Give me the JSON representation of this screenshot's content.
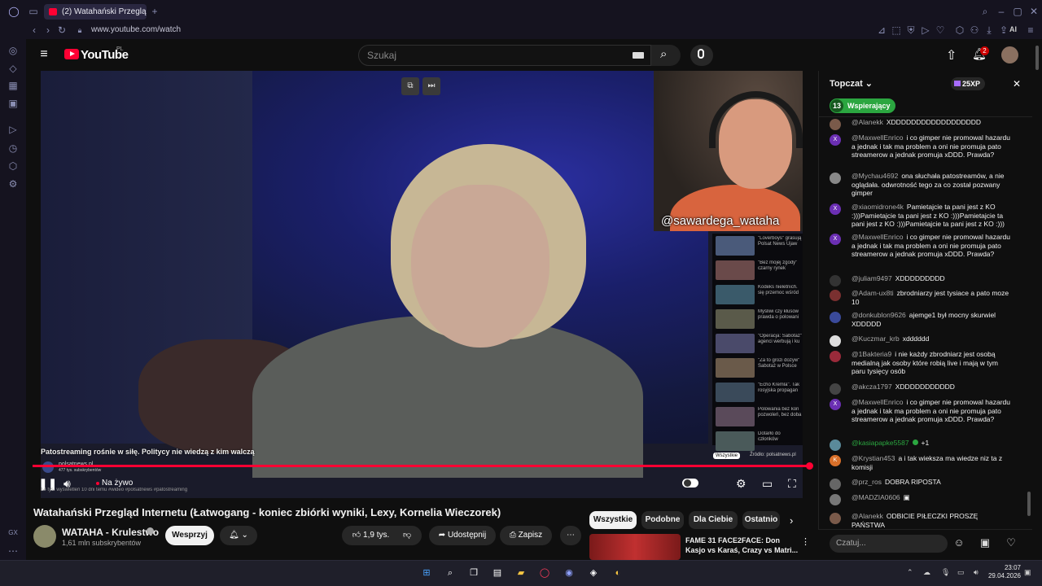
{
  "browser": {
    "tab_title": "(2) Watahański Przeglą",
    "url": "www.youtube.com/watch",
    "ai_label": "AI"
  },
  "youtube": {
    "logo_text": "YouTube",
    "logo_country": "PL",
    "search_placeholder": "Szukaj",
    "notifications_count": "2"
  },
  "video": {
    "webcam_handle": "@sawardega_wataha",
    "caption": "Patostreaming rośnie w siłę. Politycy nie wiedzą z kim walczą",
    "inner_channel": "polsatnews.pl",
    "inner_subs": "477 tys. subskrybentów",
    "inner_views": "14 tys. wyświetleń  10 dni temu  #wideo #polsatnews #patostreaming",
    "inner_source": "Źródło: polsatnews.pl",
    "inner_all": "Wszystkie",
    "live_label": "Na żywo",
    "news_items": [
      "\"Loverboys\" grasują Polsat News Ujaw",
      "\"Bez mojej zgody\" czarny rynek",
      "Kodeks nieletnich. się przemoc wśród",
      "Myśliwi czy kłusow prawda o polowani",
      "\"Operacja: Sabotaż\" agenci werbują i ku",
      "\"Za to grozi dożyw\" Sabotaż w Polsce",
      "\"Echo Kremla\". Tak rosyjska propagan",
      "Polowania bez kon pozwoleń, bez doba",
      "Dotarło do członków"
    ]
  },
  "info": {
    "title": "Watahański Przegląd Internetu (Łatwogang - koniec zbiórki wyniki, Lexy, Kornelia Wieczorek)",
    "channel_name": "WATAHA - Krulestwo",
    "channel_subs": "1,61 mln subskrybentów",
    "support_label": "Wesprzyj",
    "like_count": "1,9 tys.",
    "share_label": "Udostępnij",
    "save_label": "Zapisz"
  },
  "related": {
    "chips": [
      "Wszystkie",
      "Podobne",
      "Dla Ciebie",
      "Ostatnio"
    ],
    "first_title": "FAME 31 FACE2FACE: Don Kasjo vs Karaś, Crazy vs Matri..."
  },
  "chat": {
    "mode_label": "Topczat",
    "xp": "25XP",
    "supporting_count": "13",
    "supporting_label": "Wspierający",
    "input_placeholder": "Czatuj...",
    "messages": [
      {
        "author": "@Alanekk",
        "text": "XDDDDDDDDDDDDDDDDDD",
        "avatar": "",
        "color": "#7a5a4a",
        "mod": false
      },
      {
        "author": "@MaxwellEnrico",
        "text": "i co gimper nie promowal hazardu a jednak i tak ma problem a oni nie promuja pato streamerow a jednak promuja xDDD. Prawda?",
        "avatar": "X",
        "color": "#6b2fb3",
        "mod": false
      },
      {
        "author": "@Mychau4692",
        "text": "ona słuchała patostreamów, a nie oglądała. odwrotność tego za co został pozwany gimper",
        "avatar": "",
        "color": "#888888",
        "mod": false
      },
      {
        "author": "@xiaomidrone4k",
        "text": "Pamietajcie ta pani jest z KO :)))Pamietajcie ta pani jest z KO :)))Pamietajcie ta pani jest z KO :)))Pamietajcie ta pani jest z KO :)))",
        "avatar": "X",
        "color": "#6b2fb3",
        "mod": false
      },
      {
        "author": "@MaxwellEnrico",
        "text": "i co gimper nie promowal hazardu a jednak i tak ma problem a oni nie promuja pato streamerow a jednak promuja xDDD. Prawda?",
        "avatar": "X",
        "color": "#6b2fb3",
        "mod": false
      },
      {
        "author": "@juliam9497",
        "text": "XDDDDDDDDD",
        "avatar": "",
        "color": "#333333",
        "mod": false
      },
      {
        "author": "@Adam-ux8ti",
        "text": "zbrodniarzy jest tysiace a pato moze 10",
        "avatar": "",
        "color": "#7a3030",
        "mod": false
      },
      {
        "author": "@donkublon9626",
        "text": "ajemge1 był mocny skurwiel XDDDDD",
        "avatar": "",
        "color": "#3a4a9a",
        "mod": false
      },
      {
        "author": "@Kuczmar_krb",
        "text": "xdddddd",
        "avatar": "",
        "color": "#dddddd",
        "mod": false
      },
      {
        "author": "@1Bakteria9",
        "text": "i nie każdy zbrodniarz jest osobą medialną jak osoby które robią live i mają w tym paru tysięcy osób",
        "avatar": "",
        "color": "#9a2a3a",
        "mod": false
      },
      {
        "author": "@akcza1797",
        "text": "XDDDDDDDDDDD",
        "avatar": "",
        "color": "#444444",
        "mod": false
      },
      {
        "author": "@MaxwellEnrico",
        "text": "i co gimper nie promowal hazardu a jednak i tak ma problem a oni nie promuja pato streamerow a jednak promuja xDDD. Prawda?",
        "avatar": "X",
        "color": "#6b2fb3",
        "mod": false
      },
      {
        "author": "@kasiapapke5587",
        "text": "+1",
        "avatar": "",
        "color": "#5a8a9a",
        "mod": true
      },
      {
        "author": "@Krystian453",
        "text": "a i tak wieksza ma wiedze niz ta z komisji",
        "avatar": "K",
        "color": "#d8702a",
        "mod": false
      },
      {
        "author": "@prz_ros",
        "text": "DOBRA RIPOSTA",
        "avatar": "",
        "color": "#666666",
        "mod": false
      },
      {
        "author": "@MADZIA0606",
        "text": "▣",
        "avatar": "",
        "color": "#777777",
        "mod": false
      },
      {
        "author": "@Alanekk",
        "text": "ODBICIE PIŁECZKI PROSZĘ PAŃSTWA",
        "avatar": "",
        "color": "#7a5a4a",
        "mod": false
      }
    ]
  },
  "taskbar": {
    "time": "23:07",
    "date": "29.04.2026"
  },
  "colors": {
    "accent": "#ff0033",
    "chat_mod": "#2ba640",
    "bg": "#0f0f0f"
  }
}
